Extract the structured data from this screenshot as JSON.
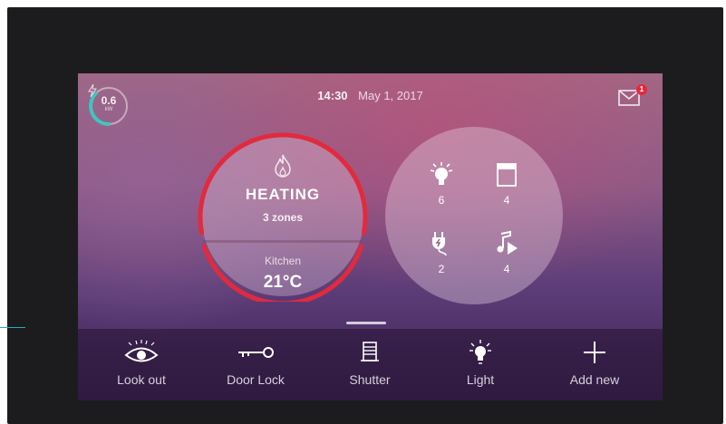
{
  "status": {
    "power_value": "0.6",
    "power_unit": "kW",
    "time": "14:30",
    "date": "May 1, 2017",
    "mail_badge": "1",
    "accent_color": "#e22a3e",
    "meter_color": "#3fc6c0"
  },
  "heating": {
    "title": "HEATING",
    "zones": "3 zones",
    "room": "Kitchen",
    "temperature": "21°C",
    "icon": "flame-icon"
  },
  "devices": [
    {
      "name": "lights",
      "icon": "light-bulb-icon",
      "count": "6"
    },
    {
      "name": "shutters",
      "icon": "shutter-icon",
      "count": "4"
    },
    {
      "name": "sockets",
      "icon": "plug-icon",
      "count": "2"
    },
    {
      "name": "music",
      "icon": "music-icon",
      "count": "4"
    }
  ],
  "dock": [
    {
      "label": "Look out",
      "icon": "eye-icon"
    },
    {
      "label": "Door Lock",
      "icon": "key-icon"
    },
    {
      "label": "Shutter",
      "icon": "shutter-icon"
    },
    {
      "label": "Light",
      "icon": "light-bulb-icon"
    },
    {
      "label": "Add new",
      "icon": "plus-icon"
    }
  ]
}
